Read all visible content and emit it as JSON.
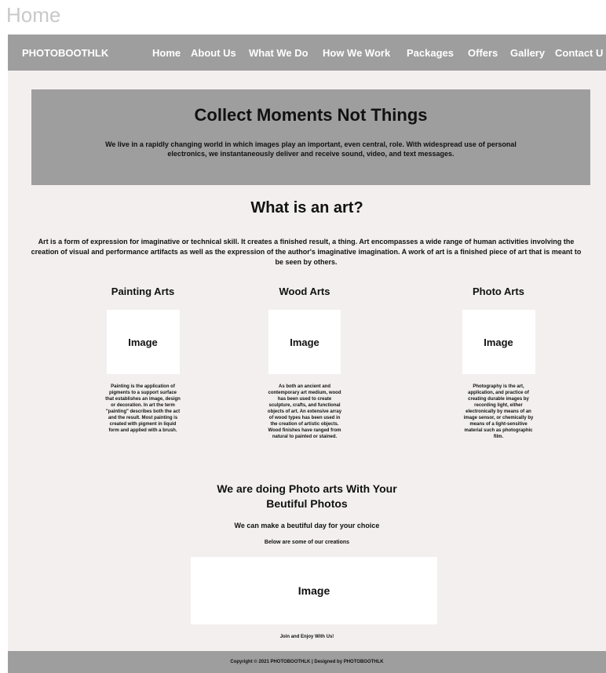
{
  "page_heading": "Home",
  "nav": {
    "brand": "PHOTOBOOTHLK",
    "links": [
      "Home",
      "About Us",
      "What We Do",
      "How We Work",
      "Packages",
      "Offers",
      "Gallery",
      "Contact U"
    ]
  },
  "hero": {
    "title": "Collect Moments Not Things",
    "text": "We live in a rapidly changing world in which images play an important, even central, role. With widespread use of personal electronics, we instantaneously deliver and receive sound, video, and text messages."
  },
  "art": {
    "title": "What is an art?",
    "text": "Art is a form of expression for imaginative or technical skill. It creates a finished result, a thing. Art encompasses a wide range of human activities involving the creation of visual and performance artifacts as well as the expression of the author's imaginative imagination. A work of art is a finished piece of art that is meant to be seen by others."
  },
  "columns": [
    {
      "title": "Painting Arts",
      "image_label": "Image",
      "text": "Painting is the application of pigments to a support surface that establishes an image, design or decoration. In art the term \"painting\" describes both the act and the result. Most painting is created with pigment in liquid form and applied with a brush."
    },
    {
      "title": "Wood Arts",
      "image_label": "Image",
      "text": "As both an ancient and contemporary art medium, wood has been used to create sculpture, crafts, and functional objects of art. An extensive array of wood types has been used in the creation of artistic objects. Wood finishes have ranged from natural to painted or stained."
    },
    {
      "title": "Photo Arts",
      "image_label": "Image",
      "text": "Photography is the art, application, and practice of creating durable images by recording light, either electronically by means of an image sensor, or chemically by means of a light-sensitive material such as photographic film."
    }
  ],
  "photo_section": {
    "title_line1": "We are doing Photo arts With Your",
    "title_line2": "Beutiful Photos",
    "subtitle": "We can make a beutiful day for your choice",
    "subtitle2": "Below are some of our creations",
    "image_label": "Image",
    "join_text": "Join and Enjoy With Us!"
  },
  "footer": {
    "text": "Copyright © 2021 PHOTOBOOTHLK | Designed by PHOTOBOOTHLK"
  }
}
